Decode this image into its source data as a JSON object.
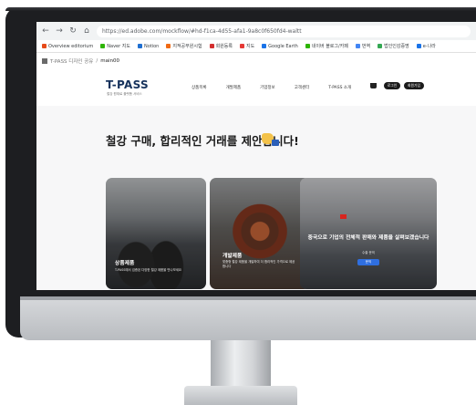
{
  "browser": {
    "url": "https://ed.adobe.com/mockflow/#hd-f1ca-4d55-afa1-9a8c0f650fd4-waltt",
    "bookmarks": [
      {
        "label": "Overview editorium",
        "color": "#e64a19"
      },
      {
        "label": "Naver 지도",
        "color": "#2db400"
      },
      {
        "label": "Notion",
        "color": "#1f6fd1"
      },
      {
        "label": "지적공무원시험",
        "color": "#f06a14"
      },
      {
        "label": "회원등록",
        "color": "#d32f2f"
      },
      {
        "label": "지도",
        "color": "#e53935"
      },
      {
        "label": "Google Earth",
        "color": "#1a73e8"
      },
      {
        "label": "네이버 블로그/카페",
        "color": "#2db400"
      },
      {
        "label": "번역",
        "color": "#4285f4"
      },
      {
        "label": "법인인감증명",
        "color": "#34a853"
      },
      {
        "label": "e-나라",
        "color": "#1a73e8"
      }
    ]
  },
  "breadcrumb": {
    "parent": "T-PASS 디자인 공유",
    "current": "main00"
  },
  "site": {
    "logo": "T-PASS",
    "logo_sub": "철강 원재료 플랫폼 서비스",
    "menu": [
      "상품목록",
      "개발제품",
      "기업정보",
      "고객센터",
      "T-PASS 소개"
    ],
    "login_label": "로그인",
    "signup_label": "회원가입",
    "headline": "철강 구매, 합리적인 거래를 제안합니다!",
    "cards": [
      {
        "title": "상품제품",
        "desc": "T-PASS에서 검증된 다양한 철강 제품을 만나보세요"
      },
      {
        "title": "개발제품",
        "desc": "맞춤형 철강 제품을 개발하여 더 합리적인 가격으로 제공합니다"
      },
      {
        "title": "중국으로 기업의 전체적 판매와 제품을 살펴보겠습니다",
        "sub": "수출 문의",
        "button": "문의"
      }
    ]
  },
  "colors": {
    "brand": "#16325c",
    "accent": "#2f6fe0"
  }
}
